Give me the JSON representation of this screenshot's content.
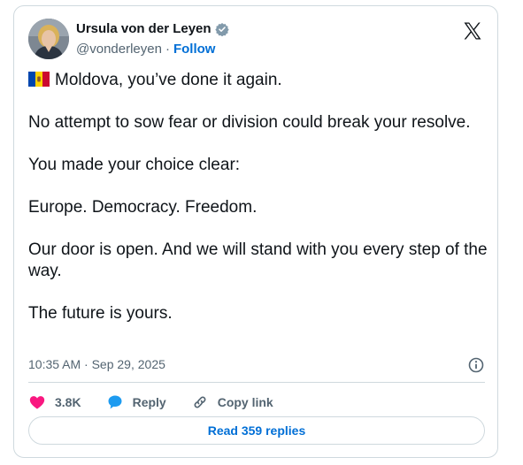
{
  "author": {
    "name": "Ursula von der Leyen",
    "handle": "@vonderleyen",
    "separator": "·",
    "follow_label": "Follow",
    "verified_color": "#829aab"
  },
  "icons": {
    "logo": "x-logo-icon",
    "flag": "moldova-flag-icon",
    "like": "heart-icon",
    "reply": "speech-bubble-icon",
    "copy": "link-icon",
    "info": "info-icon"
  },
  "post": {
    "paragraphs": [
      "Moldova, you’ve done it again.",
      "No attempt to sow fear or division could break your resolve.",
      "You made your choice clear:",
      "Europe. Democracy. Freedom.",
      "Our door is open. And we will stand with you every step of the way.",
      "The future is yours."
    ],
    "timestamp": "10:35 AM · Sep 29, 2025"
  },
  "actions": {
    "likes_count": "3.8K",
    "reply_label": "Reply",
    "copy_label": "Copy link"
  },
  "footer": {
    "read_replies_label": "Read 359 replies"
  },
  "colors": {
    "like": "#f91880",
    "reply": "#1d9bf0",
    "link": "#006fd6",
    "muted": "#536471",
    "border": "#cfd9de"
  }
}
